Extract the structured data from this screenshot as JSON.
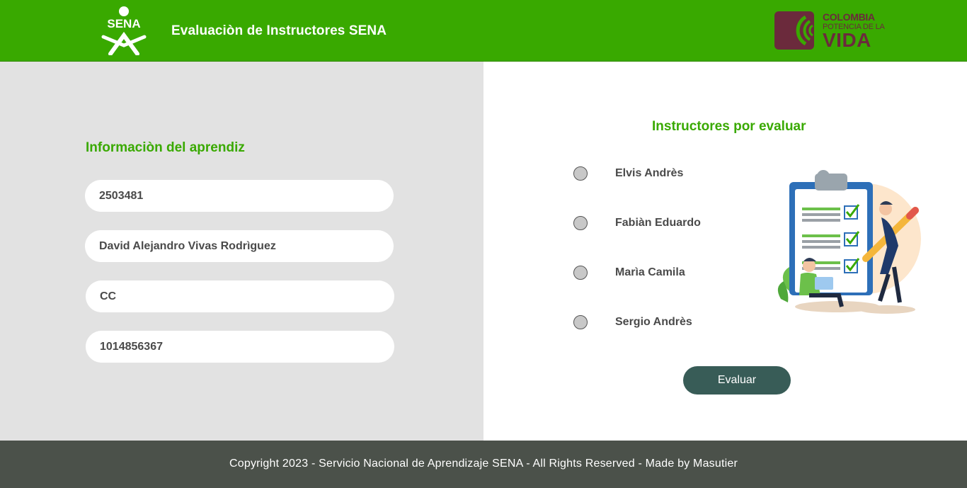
{
  "header": {
    "brand_text": "SENA",
    "title": "Evaluaciòn de Instructores SENA",
    "gov_logo": {
      "line1": "COLOMBIA",
      "line2": "POTENCIA DE LA",
      "line3": "VIDA"
    }
  },
  "learner": {
    "section_title": "Informaciòn del aprendiz",
    "fields": [
      {
        "value": "2503481"
      },
      {
        "value": "David Alejandro Vivas Rodrìguez"
      },
      {
        "value": "CC"
      },
      {
        "value": "1014856367"
      }
    ]
  },
  "instructors": {
    "section_title": "Instructores por evaluar",
    "options": [
      {
        "label": "Elvis Andrès"
      },
      {
        "label": "Fabiàn Eduardo"
      },
      {
        "label": "Marìa Camila"
      },
      {
        "label": "Sergio Andrès"
      }
    ],
    "submit_label": "Evaluar"
  },
  "footer": {
    "text": "Copyright 2023 - Servicio Nacional de Aprendizaje SENA - All Rights Reserved - Made by Masutier"
  },
  "colors": {
    "brand_green": "#39a900",
    "panel_gray": "#e2e2e2",
    "button": "#385c57",
    "footer_bg": "#4b514a"
  }
}
